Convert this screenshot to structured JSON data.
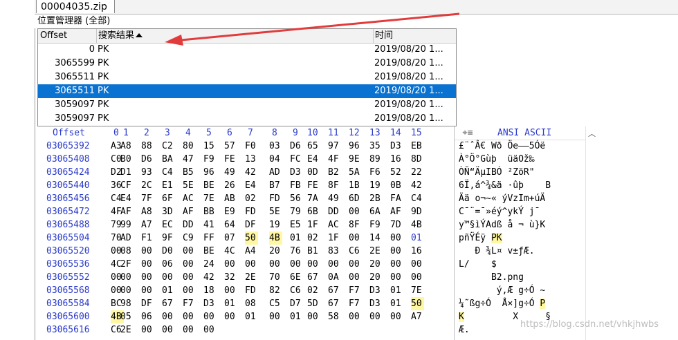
{
  "window": {
    "tab_title": "00004035.zip"
  },
  "panel": {
    "title": "位置管理器 (全部)"
  },
  "results_table": {
    "columns": {
      "offset": "Offset",
      "result": "搜索结果",
      "time": "时间"
    },
    "rows": [
      {
        "offset": "0",
        "result": "PK",
        "time": "2019/08/20  1...",
        "selected": false
      },
      {
        "offset": "3065599",
        "result": "PK",
        "time": "2019/08/20  1...",
        "selected": false
      },
      {
        "offset": "3065511",
        "result": "PK",
        "time": "2019/08/20  1...",
        "selected": false
      },
      {
        "offset": "3065511",
        "result": "PK",
        "time": "2019/08/20  1...",
        "selected": true
      },
      {
        "offset": "3059097",
        "result": "PK",
        "time": "2019/08/20  1...",
        "selected": false
      },
      {
        "offset": "3059097",
        "result": "PK",
        "time": "2019/08/20  1...",
        "selected": false
      }
    ]
  },
  "hex_view": {
    "offset_label": "Offset",
    "column_headers": [
      "0",
      "1",
      "2",
      "3",
      "4",
      "5",
      "6",
      "7",
      "8",
      "9",
      "10",
      "11",
      "12",
      "13",
      "14",
      "15"
    ],
    "rows": [
      {
        "addr": "03065392",
        "bytes": [
          "A3",
          "A8",
          "88",
          "C2",
          "80",
          "15",
          "57",
          "F0",
          "03",
          "D6",
          "65",
          "97",
          "96",
          "35",
          "D3",
          "EB"
        ]
      },
      {
        "addr": "03065408",
        "bytes": [
          "C0",
          "B0",
          "D6",
          "BA",
          "47",
          "F9",
          "FE",
          "13",
          "04",
          "FC",
          "E4",
          "4F",
          "9E",
          "89",
          "16",
          "8D"
        ]
      },
      {
        "addr": "03065424",
        "bytes": [
          "D2",
          "D1",
          "93",
          "C4",
          "B5",
          "96",
          "49",
          "42",
          "AD",
          "D3",
          "0D",
          "B2",
          "5A",
          "F6",
          "52",
          "22"
        ]
      },
      {
        "addr": "03065440",
        "bytes": [
          "36",
          "CF",
          "2C",
          "E1",
          "5E",
          "BE",
          "26",
          "E4",
          "B7",
          "FB",
          "FE",
          "8F",
          "1B",
          "19",
          "0B",
          "42"
        ]
      },
      {
        "addr": "03065456",
        "bytes": [
          "C4",
          "E4",
          "7F",
          "6F",
          "AC",
          "7E",
          "AB",
          "02",
          "FD",
          "56",
          "7A",
          "49",
          "6D",
          "2B",
          "FA",
          "C4"
        ]
      },
      {
        "addr": "03065472",
        "bytes": [
          "4F",
          "AF",
          "A8",
          "3D",
          "AF",
          "BB",
          "E9",
          "FD",
          "5E",
          "79",
          "6B",
          "DD",
          "00",
          "6A",
          "AF",
          "9D"
        ]
      },
      {
        "addr": "03065488",
        "bytes": [
          "79",
          "99",
          "A7",
          "EC",
          "DD",
          "41",
          "64",
          "DF",
          "19",
          "E5",
          "1F",
          "AC",
          "8F",
          "F9",
          "7D",
          "4B"
        ]
      },
      {
        "addr": "03065504",
        "bytes": [
          "70",
          "AD",
          "F1",
          "9F",
          "C9",
          "FF",
          "07",
          "50",
          "4B",
          "01",
          "02",
          "1F",
          "00",
          "14",
          "00",
          "01"
        ]
      },
      {
        "addr": "03065520",
        "bytes": [
          "00",
          "08",
          "00",
          "D0",
          "00",
          "BE",
          "4C",
          "A4",
          "20",
          "76",
          "B1",
          "83",
          "C6",
          "2E",
          "00",
          "16"
        ]
      },
      {
        "addr": "03065536",
        "bytes": [
          "4C",
          "2F",
          "00",
          "06",
          "00",
          "24",
          "00",
          "00",
          "00",
          "00",
          "00",
          "00",
          "00",
          "20",
          "00",
          "00"
        ]
      },
      {
        "addr": "03065552",
        "bytes": [
          "00",
          "00",
          "00",
          "00",
          "00",
          "42",
          "32",
          "2E",
          "70",
          "6E",
          "67",
          "0A",
          "00",
          "20",
          "00",
          "00"
        ]
      },
      {
        "addr": "03065568",
        "bytes": [
          "00",
          "00",
          "00",
          "01",
          "00",
          "18",
          "00",
          "FD",
          "82",
          "C6",
          "02",
          "67",
          "F7",
          "D3",
          "01",
          "7E"
        ]
      },
      {
        "addr": "03065584",
        "bytes": [
          "BC",
          "98",
          "DF",
          "67",
          "F7",
          "D3",
          "01",
          "08",
          "C5",
          "D7",
          "5D",
          "67",
          "F7",
          "D3",
          "01",
          "50"
        ]
      },
      {
        "addr": "03065600",
        "bytes": [
          "4B",
          "05",
          "06",
          "00",
          "00",
          "00",
          "00",
          "01",
          "00",
          "01",
          "00",
          "58",
          "00",
          "00",
          "00",
          "A7"
        ]
      },
      {
        "addr": "03065616",
        "bytes": [
          "C6",
          "2E",
          "00",
          "00",
          "00",
          "00",
          "",
          "",
          "",
          "",
          "",
          "",
          "",
          "",
          "",
          ""
        ]
      }
    ]
  },
  "ascii_view": {
    "header_label": "ANSI ASCII",
    "rows": [
      "£¨ˆÂ€ Wð Öe—–5Óë",
      "À°Ö°Gùþ  üäOž‰",
      "ÒÑ“ÄµIB­Ó ²ZöR\"",
      "6Ï‚á^¾&ä ·ûþ    B",
      "Ää o¬~« ýVzIm+úÄ",
      "C¯¨=¯»éý^ykÝ j¯",
      "y™§ìÝAdß å ¬ ù}K",
      "p­ñŸÉÿ PK",
      "   Ð ¾L¤ v±ƒÆ.",
      "L/    $",
      "      B2.png",
      "       ý‚Æ g÷Ó ~",
      "¼˜ßg÷Ó  Å×]g÷Ó P",
      "K         X     §",
      "Æ."
    ]
  },
  "watermark": {
    "text": "https://blog.csdn.net/vhkjhwbs"
  },
  "colors": {
    "selection": "#0a73d1",
    "highlight": "#fff7a1",
    "offset_blue": "#2a3acb",
    "annotation_arrow": "#e23b3b"
  },
  "icons": {
    "ascii_header_icon": "crosshair-icon",
    "sort_indicator": "sort-ascending-icon",
    "scroll_up": "chevron-up-icon"
  }
}
